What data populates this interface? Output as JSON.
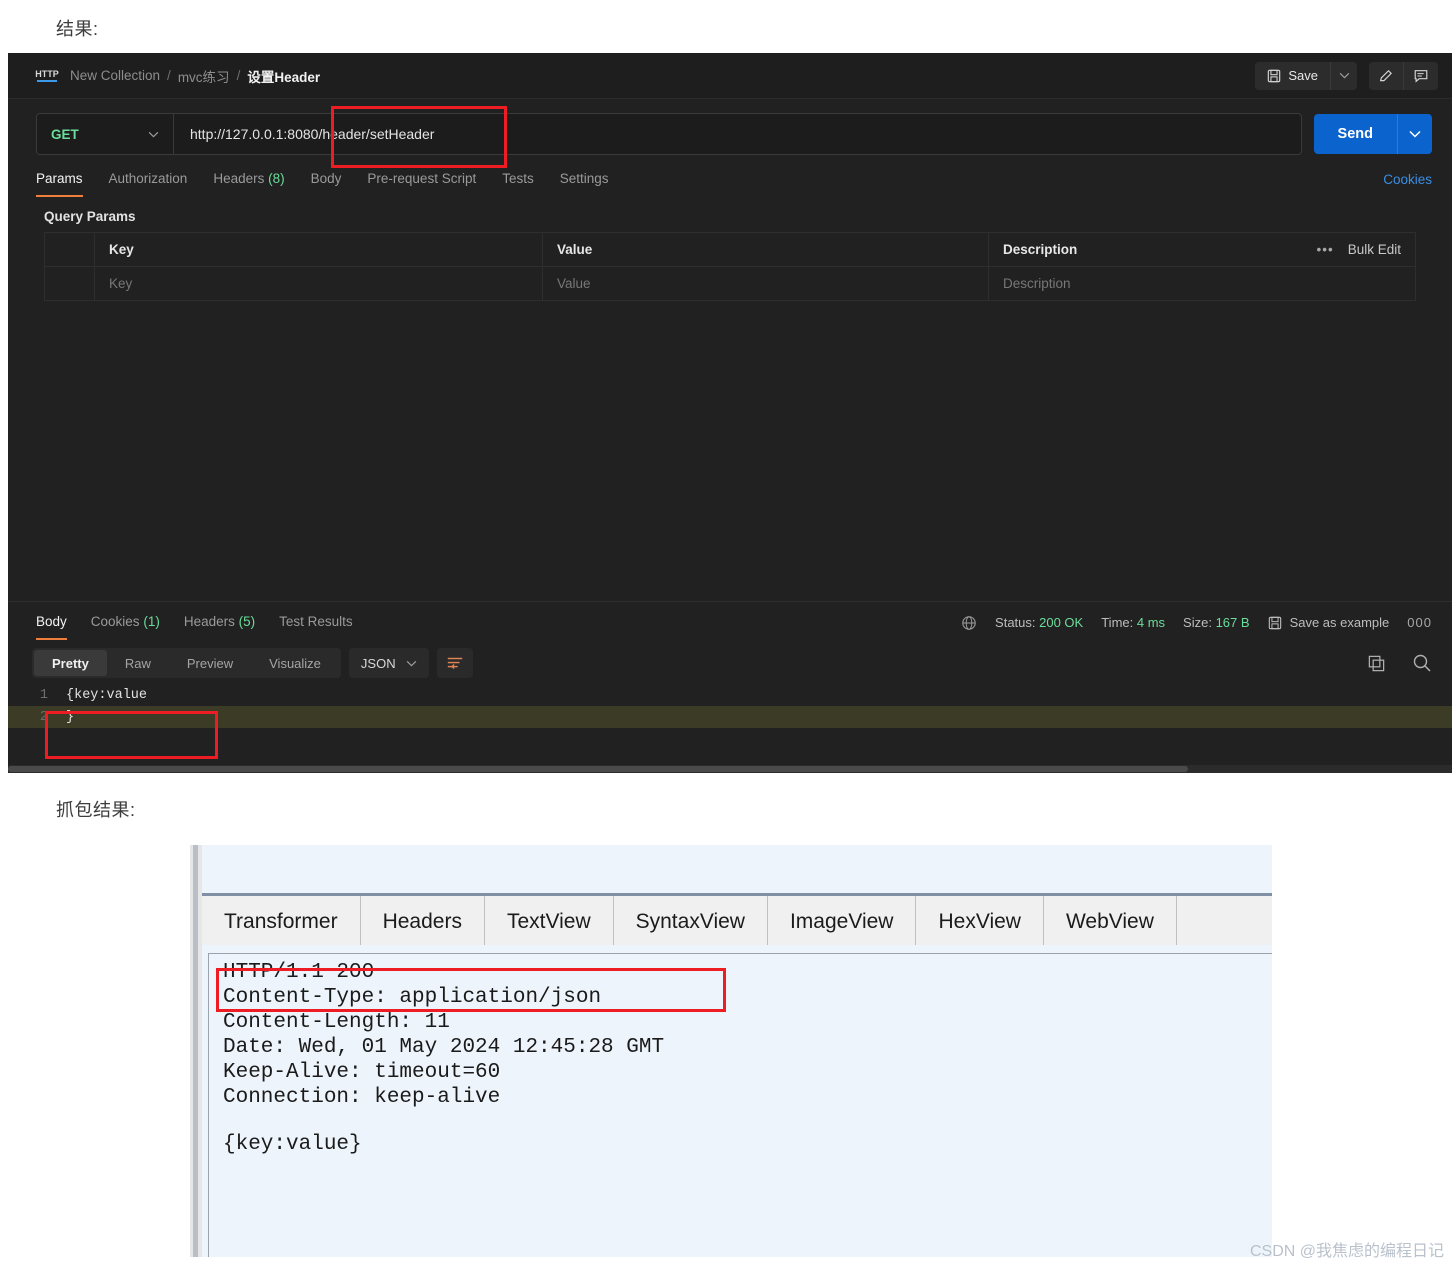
{
  "captions": {
    "result": "结果:",
    "capture": "抓包结果:"
  },
  "postman": {
    "breadcrumb": {
      "app_badge": "HTTP",
      "collection": "New Collection",
      "folder": "mvc练习",
      "separator": "/",
      "current": "设置Header"
    },
    "header_actions": {
      "save_label": "Save",
      "save_caret": "chevron-down",
      "edit_icon": "pencil",
      "comment_icon": "comment"
    },
    "request": {
      "method": "GET",
      "url": "http://127.0.0.1:8080/header/setHeader",
      "send_label": "Send"
    },
    "tabs": [
      {
        "label": "Params",
        "count": "",
        "active": true
      },
      {
        "label": "Authorization",
        "count": "",
        "active": false
      },
      {
        "label": "Headers",
        "count": "(8)",
        "active": false
      },
      {
        "label": "Body",
        "count": "",
        "active": false
      },
      {
        "label": "Pre-request Script",
        "count": "",
        "active": false
      },
      {
        "label": "Tests",
        "count": "",
        "active": false
      },
      {
        "label": "Settings",
        "count": "",
        "active": false
      }
    ],
    "cookies_link": "Cookies",
    "query_params": {
      "title": "Query Params",
      "headers": {
        "key": "Key",
        "value": "Value",
        "description": "Description"
      },
      "bulk_edit": "Bulk Edit",
      "more_dots": "•••",
      "placeholder_row": {
        "key": "Key",
        "value": "Value",
        "description": "Description"
      }
    },
    "response": {
      "tabs": [
        {
          "label": "Body",
          "count": "",
          "active": true
        },
        {
          "label": "Cookies",
          "count": "(1)",
          "active": false
        },
        {
          "label": "Headers",
          "count": "(5)",
          "active": false
        },
        {
          "label": "Test Results",
          "count": "",
          "active": false
        }
      ],
      "status_label": "Status:",
      "status_value": "200 OK",
      "time_label": "Time:",
      "time_value": "4 ms",
      "size_label": "Size:",
      "size_value": "167 B",
      "save_example": "Save as example",
      "more_dots": "000",
      "view_modes": [
        {
          "label": "Pretty",
          "active": true
        },
        {
          "label": "Raw",
          "active": false
        },
        {
          "label": "Preview",
          "active": false
        },
        {
          "label": "Visualize",
          "active": false
        }
      ],
      "format": "JSON",
      "body_lines": [
        {
          "no": "1",
          "text": "{key:value",
          "highlight": false
        },
        {
          "no": "2",
          "text": "}",
          "highlight": true
        }
      ]
    }
  },
  "fiddler": {
    "tabs": [
      "Transformer",
      "Headers",
      "TextView",
      "SyntaxView",
      "ImageView",
      "HexView",
      "WebView"
    ],
    "raw_lines": [
      "HTTP/1.1 200",
      "Content-Type: application/json",
      "Content-Length: 11",
      "Date: Wed, 01 May 2024 12:45:28 GMT",
      "Keep-Alive: timeout=60",
      "Connection: keep-alive"
    ],
    "body": "{key:value}"
  },
  "watermark": "CSDN @我焦虑的编程日记"
}
